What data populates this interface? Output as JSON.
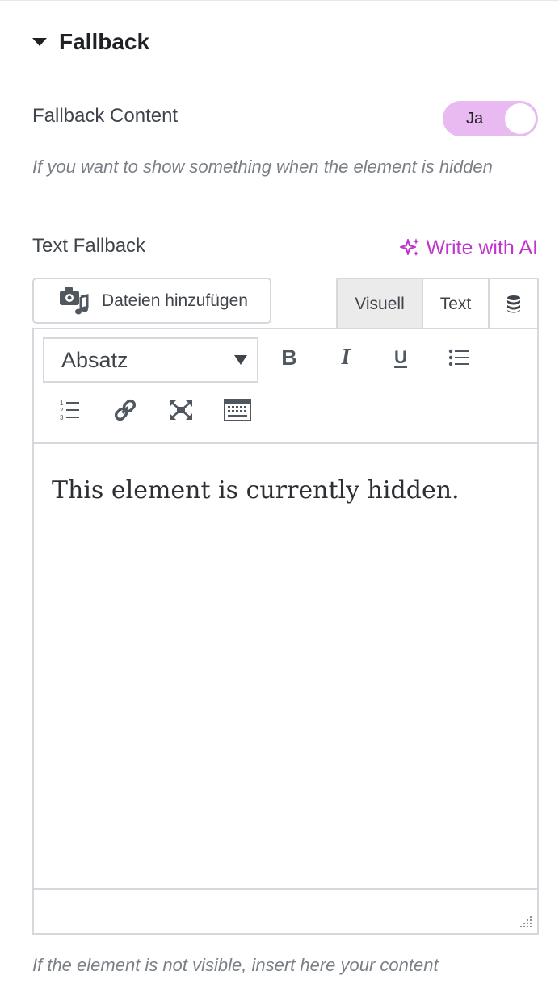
{
  "section": {
    "title": "Fallback"
  },
  "fallback_content": {
    "label": "Fallback Content",
    "toggle_value": "Ja",
    "enabled": true
  },
  "fallback_description": "If you want to show something when the element is hidden",
  "text_fallback": {
    "label": "Text Fallback",
    "ai_link": "Write with AI"
  },
  "editor": {
    "media_button": "Dateien hinzufügen",
    "tabs": [
      {
        "label": "Visuell",
        "active": true
      },
      {
        "label": "Text",
        "active": false
      }
    ],
    "dynamic_tag_icon": "database-icon",
    "format_select": "Absatz",
    "toolbar_icons": [
      "bold-icon",
      "italic-icon",
      "underline-icon",
      "bullet-list-icon",
      "numbered-list-icon",
      "link-icon",
      "fullscreen-icon",
      "toolbar-toggle-icon"
    ],
    "content": "This element is currently hidden."
  },
  "bottom_description": "If the element is not visible, insert here your content",
  "colors": {
    "accent": "#c036cc",
    "toggle_bg": "#e9b9f2",
    "border": "#d5d8dc",
    "active_tab": "#ebebeb"
  }
}
